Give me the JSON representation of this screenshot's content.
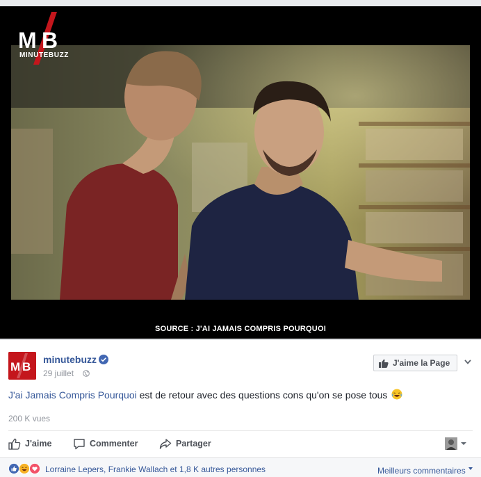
{
  "video": {
    "brand": "MINUTEBUZZ",
    "subtitle": "SOURCE : J'AI JAMAIS COMPRIS POURQUOI"
  },
  "post": {
    "page_name": "minutebuzz",
    "date": "29 juillet",
    "like_page_label": "J'aime la Page",
    "text_link": "J'ai Jamais Compris Pourquoi",
    "text_rest": " est de retour avec des questions cons qu'on se pose tous",
    "views": "200 K vues"
  },
  "actions": {
    "like": "J'aime",
    "comment": "Commenter",
    "share": "Partager"
  },
  "reactions": {
    "summary": "Lorraine Lepers, Frankie Wallach et 1,8 K autres personnes",
    "sort_label": "Meilleurs commentaires"
  },
  "icons": [
    "minutebuzz-logo-icon",
    "verified-badge-icon",
    "globe-icon",
    "thumbs-up-icon",
    "comment-icon",
    "share-icon",
    "chevron-down-icon",
    "laughing-emoji-icon",
    "like-reaction-icon",
    "haha-reaction-icon",
    "love-reaction-icon"
  ],
  "colors": {
    "brand_red": "#c4161c",
    "link_blue": "#365899",
    "verified_blue": "#4267b2",
    "love_red": "#f25268",
    "haha_yellow": "#f7b125"
  }
}
